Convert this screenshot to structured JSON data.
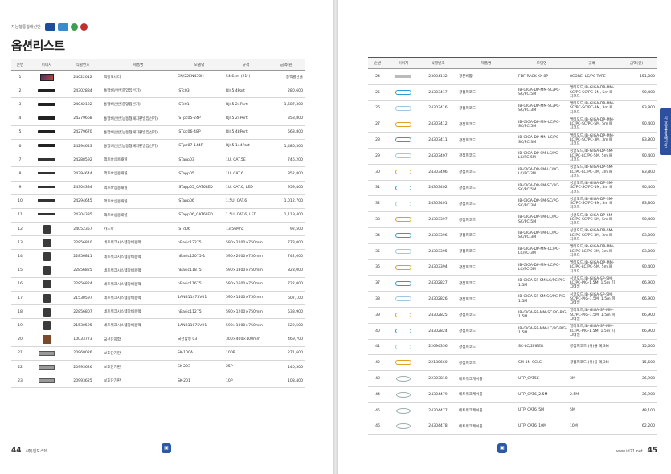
{
  "header": {
    "category": "지능형통합배선반"
  },
  "title": "옵션리스트",
  "columns": [
    "순번",
    "이미지",
    "식별번호",
    "제품명",
    "모델명",
    "규격",
    "금액(원)"
  ],
  "left_rows": [
    {
      "no": "1",
      "icon": "monitor-thumbnail",
      "id": "24022012",
      "name": "액정모니터",
      "model": "CN/22EN430H",
      "spec": "54.6cm (21\")",
      "price": "총액별산출"
    },
    {
      "no": "2",
      "icon": "switch-thumbnail",
      "id": "24302884",
      "name": "통합배선반(중앙집선기)",
      "model": "ISTc03",
      "spec": "RJ45 4Port",
      "price": "280,600"
    },
    {
      "no": "3",
      "icon": "switch-thumbnail",
      "id": "24042122",
      "name": "통합배선반(중앙집선기)",
      "model": "ISTc01",
      "spec": "RJ45 24Port",
      "price": "1,687,300"
    },
    {
      "no": "4",
      "icon": "switch-thumbnail",
      "id": "24279668",
      "name": "통합배선반(능동형패치판넬집선기)",
      "model": "ISTpc05-24P",
      "spec": "RJ45 24Port",
      "price": "358,800"
    },
    {
      "no": "5",
      "icon": "switch-thumbnail",
      "id": "24279670",
      "name": "통합배선반(능동형패치판넬집선기)",
      "model": "ISTpc06-48P",
      "spec": "RJ45 48Port",
      "price": "563,800"
    },
    {
      "no": "6",
      "icon": "switch-thumbnail",
      "id": "24294643",
      "name": "통합배선반(능동형패치판넬집선기)",
      "model": "ISTpc07-144P",
      "spec": "RJ45 144Port",
      "price": "1,486,300"
    },
    {
      "no": "7",
      "icon": "patch-panel-thumbnail",
      "id": "24288592",
      "name": "액트바상용패널",
      "model": "ISTapp03",
      "spec": "1U, CAT.5E",
      "price": "746,200"
    },
    {
      "no": "8",
      "icon": "patch-panel-thumbnail",
      "id": "24294644",
      "name": "액트바상용패널",
      "model": "ISTapp05",
      "spec": "1U, CAT.6",
      "price": "852,800"
    },
    {
      "no": "9",
      "icon": "patch-panel-thumbnail",
      "id": "24304334",
      "name": "액트바상용패널",
      "model": "ISTapp05_CAT6LED",
      "spec": "1U, CAT.6, LED",
      "price": "959,400"
    },
    {
      "no": "10",
      "icon": "patch-panel-thumbnail",
      "id": "24294645",
      "name": "액트바상용패널",
      "model": "ISTapp06",
      "spec": "1.5U, CAT.6",
      "price": "1,012,700"
    },
    {
      "no": "11",
      "icon": "patch-panel-thumbnail",
      "id": "24304335",
      "name": "액트바상용패널",
      "model": "ISTapp06_CAT6LED",
      "spec": "1.5U, CAT.6, LED",
      "price": "1,119,400"
    },
    {
      "no": "12",
      "icon": "card-reader-thumbnail",
      "id": "24052357",
      "name": "카드락",
      "model": "ISTd06",
      "spec": "13.56Mhz",
      "price": "92,500"
    },
    {
      "no": "13",
      "icon": "rack-thumbnail",
      "id": "22856810",
      "name": "네트워크시스템장비용랙",
      "model": "nBasic12275",
      "spec": "590×2200×750mm",
      "price": "778,000"
    },
    {
      "no": "14",
      "icon": "rack-thumbnail",
      "id": "22856811",
      "name": "네트워크시스템장비용랙",
      "model": "nBasic12075-1",
      "spec": "590×2000×750mm",
      "price": "742,000"
    },
    {
      "no": "15",
      "icon": "rack-thumbnail",
      "id": "22856825",
      "name": "네트워크시스템장비용랙",
      "model": "nBasic11875",
      "spec": "590×1800×750mm",
      "price": "823,000"
    },
    {
      "no": "16",
      "icon": "rack-thumbnail",
      "id": "22856824",
      "name": "네트워크시스템장비용랙",
      "model": "nBasic11675",
      "spec": "590×1600×750mm",
      "price": "722,000"
    },
    {
      "no": "17",
      "icon": "rack-thumbnail",
      "id": "21530597",
      "name": "네트워크시스템장비용랙",
      "model": "1ANB11475V01",
      "spec": "590×1400×750mm",
      "price": "607,100"
    },
    {
      "no": "18",
      "icon": "rack-thumbnail",
      "id": "22856807",
      "name": "네트워크시스템장비용랙",
      "model": "nBasic11275",
      "spec": "590×1200×750mm",
      "price": "538,900"
    },
    {
      "no": "19",
      "icon": "rack-thumbnail",
      "id": "21530595",
      "name": "네트워크시스템장비용랙",
      "model": "1ANB11075V01",
      "spec": "590×1000×750mm",
      "price": "529,500"
    },
    {
      "no": "20",
      "icon": "cabinet-thumbnail",
      "id": "10033773",
      "name": "국선단자함",
      "model": "국선함형 03",
      "spec": "300×400×100mm",
      "price": "469,700"
    },
    {
      "no": "21",
      "icon": "terminal-board-thumbnail",
      "id": "20969026",
      "name": "보호단기판",
      "model": "SK-100A",
      "spec": "100P",
      "price": "271,600"
    },
    {
      "no": "22",
      "icon": "terminal-board-thumbnail",
      "id": "20993626",
      "name": "보호단기판",
      "model": "SK-203",
      "spec": "25P",
      "price": "140,300"
    },
    {
      "no": "23",
      "icon": "terminal-board-thumbnail",
      "id": "20993625",
      "name": "보호단기판",
      "model": "SK-201",
      "spec": "10P",
      "price": "108,400"
    }
  ],
  "right_rows": [
    {
      "no": "24",
      "icon": "fiber-tray-thumbnail",
      "id": "23034132",
      "name": "광분배함",
      "model": "FDF-RACK-XX-8P",
      "spec": "8CORE, LC/PC TYPE",
      "price": "151,000"
    },
    {
      "no": "25",
      "icon": "fiber-cord-thumbnail",
      "id": "24303417",
      "name": "광점퍼코드",
      "model": "IB-GIGA-DP-MM-SC/PC-SC/PC-5M",
      "spec": "멀티모드,IB-GIGA-DP-MM-SC/PC-SC/PC-5M, 5m 패치코드",
      "price": "90,400"
    },
    {
      "no": "26",
      "icon": "fiber-cord-thumbnail",
      "id": "24303416",
      "name": "광점퍼코드",
      "model": "IB-GIGA-DP-MM-SC/PC-SC/PC-3M",
      "spec": "멀티모드,IB-GIGA-DP-MM-SC/PC-SC/PC-3M, 3m 패치코드",
      "price": "83,800"
    },
    {
      "no": "27",
      "icon": "fiber-cord-thumbnail",
      "id": "24303412",
      "name": "광점퍼코드",
      "model": "IB-GIGA-DP-MM-LC/PC-SC/PC-5M",
      "spec": "멀티모드,IB-GIGA-DP-MM-LC/PC-SC/PC-5M, 5m 패치코드",
      "price": "90,400"
    },
    {
      "no": "28",
      "icon": "fiber-cord-thumbnail",
      "id": "24303411",
      "name": "광점퍼코드",
      "model": "IB-GIGA-DP-MM-LC/PC-SC/PC-3M",
      "spec": "멀티모드,IB-GIGA-DP-MM-LC/PC-SC/PC-3M, 3m 패치코드",
      "price": "83,800"
    },
    {
      "no": "29",
      "icon": "fiber-cord-thumbnail",
      "id": "24303407",
      "name": "광점퍼코드",
      "model": "IB-GIGA-DP-SM-LC/PC-LC/PC-5M",
      "spec": "싱글모드,IB-GIGA-DP-SM-LC/PC-LC/PC-5M, 5m 패치코드",
      "price": "90,400"
    },
    {
      "no": "30",
      "icon": "fiber-cord-thumbnail",
      "id": "24303406",
      "name": "광점퍼코드",
      "model": "IB-GIGA-DP-SM-LC/PC-LC/PC-3M",
      "spec": "싱글모드,IB-GIGA-DP-SM-LC/PC-LC/PC-3M, 3m 패치코드",
      "price": "83,800"
    },
    {
      "no": "31",
      "icon": "fiber-cord-thumbnail",
      "id": "24303402",
      "name": "광점퍼코드",
      "model": "IB-GIGA-DP-SM-SC/PC-SC/PC-5M",
      "spec": "싱글모드,IB-GIGA-DP-SM-SC/PC-SC/PC-5M, 5m 패치코드",
      "price": "90,400"
    },
    {
      "no": "32",
      "icon": "fiber-cord-thumbnail",
      "id": "24303401",
      "name": "광점퍼코드",
      "model": "IB-GIGA-DP-SM-SC/PC-SC/PC-3M",
      "spec": "싱글모드,IB-GIGA-DP-SM-SC/PC-SC/PC-3M, 3m 패치코드",
      "price": "83,800"
    },
    {
      "no": "33",
      "icon": "fiber-cord-thumbnail",
      "id": "24303397",
      "name": "광점퍼코드",
      "model": "IB-GIGA-DP-SM-LC/PC-SC/PC-5M",
      "spec": "싱글모드,IB-GIGA-DP-SM-LC/PC-SC/PC-5M, 5m 패치코드",
      "price": "90,400"
    },
    {
      "no": "34",
      "icon": "fiber-cord-thumbnail",
      "id": "24303396",
      "name": "광점퍼코드",
      "model": "IB-GIGA-DP-SM-LC/PC-SC/PC-3M",
      "spec": "싱글모드,IB-GIGA-DP-SM-LC/PC-SC/PC-3M, 3m 패치코드",
      "price": "83,800"
    },
    {
      "no": "35",
      "icon": "fiber-cord-thumbnail",
      "id": "24303395",
      "name": "광점퍼코드",
      "model": "IB-GIGA-DP-MM-LC/PC-LC/PC-3M",
      "spec": "멀티모드,IB-GIGA-DP-MM-LC/PC-LC/PC-3M, 3m 패치코드",
      "price": "83,800"
    },
    {
      "no": "36",
      "icon": "fiber-cord-thumbnail",
      "id": "24303394",
      "name": "광점퍼코드",
      "model": "IB-GIGA-DP-MM-LC/PC-LC/PC-5M",
      "spec": "멀티모드,IB-GIGA-DP-MM-LC/PC-LC/PC-5M, 5m 패치코드",
      "price": "90,400"
    },
    {
      "no": "37",
      "icon": "fiber-cord-thumbnail",
      "id": "24302827",
      "name": "광점퍼코드",
      "model": "IB-GIGA-SP-SM-LC/PC-PIG-1.5M",
      "spec": "싱글모드,IB-GIGA-SP-SM-LC/PC-PIG-1.5M, 1.5m 피그테일",
      "price": "66,900"
    },
    {
      "no": "38",
      "icon": "fiber-cord-thumbnail",
      "id": "24302826",
      "name": "광점퍼코드",
      "model": "IB-GIGA-SP-SM-SC/PC-PIG-1.5M",
      "spec": "싱글모드,IB-GIGA-SP-SM-SC/PC-PIG-1.5M, 1.5m 피그테일",
      "price": "66,900"
    },
    {
      "no": "39",
      "icon": "fiber-cord-thumbnail",
      "id": "24302825",
      "name": "광점퍼코드",
      "model": "IB-GIGA-SP-MM-SC/PC-PIG-1.5M",
      "spec": "멀티모드,IB-GIGA-SP-MM-SC/PC-PIG-1.5M, 1.5m 피그테일",
      "price": "66,900"
    },
    {
      "no": "40",
      "icon": "fiber-cord-thumbnail",
      "id": "24302824",
      "name": "광점퍼코드",
      "model": "IB-GIGA-SP-MM-LC/PC-PIG-1.5M",
      "spec": "멀티모드,IB-GIGA-SP-MM-LC/PC-PIG-1.5M, 1.5m 피그테일",
      "price": "66,900"
    },
    {
      "no": "41",
      "icon": "fiber-cord-thumbnail",
      "id": "22694356",
      "name": "광점퍼코드",
      "model": "SC-LC/2FIBER",
      "spec": "광점퍼코드,(위)을 예,3M",
      "price": "15,600"
    },
    {
      "no": "42",
      "icon": "fiber-cord-thumbnail",
      "id": "22180660",
      "name": "광점퍼코드",
      "model": "SM-3M-SCLC",
      "spec": "광점퍼코드,(위)을 예,3M",
      "price": "15,600"
    },
    {
      "no": "43",
      "icon": "utp-cable-thumbnail",
      "id": "22303810",
      "name": "네트워크케이블",
      "model": "UTP_CAT5E",
      "spec": "3M",
      "price": "36,900"
    },
    {
      "no": "44",
      "icon": "utp-cable-thumbnail",
      "id": "24304479",
      "name": "네트워크케이블",
      "model": "UTP_CAT6_2.5M",
      "spec": "2.5M",
      "price": "36,900"
    },
    {
      "no": "45",
      "icon": "utp-cable-thumbnail",
      "id": "24304477",
      "name": "네트워크케이블",
      "model": "UTP_CAT6_5M",
      "spec": "5M",
      "price": "48,100"
    },
    {
      "no": "46",
      "icon": "utp-cable-thumbnail",
      "id": "24304478",
      "name": "네트워크케이블",
      "model": "UTP_CAT6_10M",
      "spec": "10M",
      "price": "62,200"
    }
  ],
  "footer": {
    "left_page": "44",
    "left_company": "(주)인포스텍",
    "right_page": "45",
    "right_site": "www.id21.net"
  },
  "side_tab": "지능형통합배선반",
  "colors": {
    "accent": "#2c4f9e",
    "header_bg": "#f4f4f4"
  }
}
